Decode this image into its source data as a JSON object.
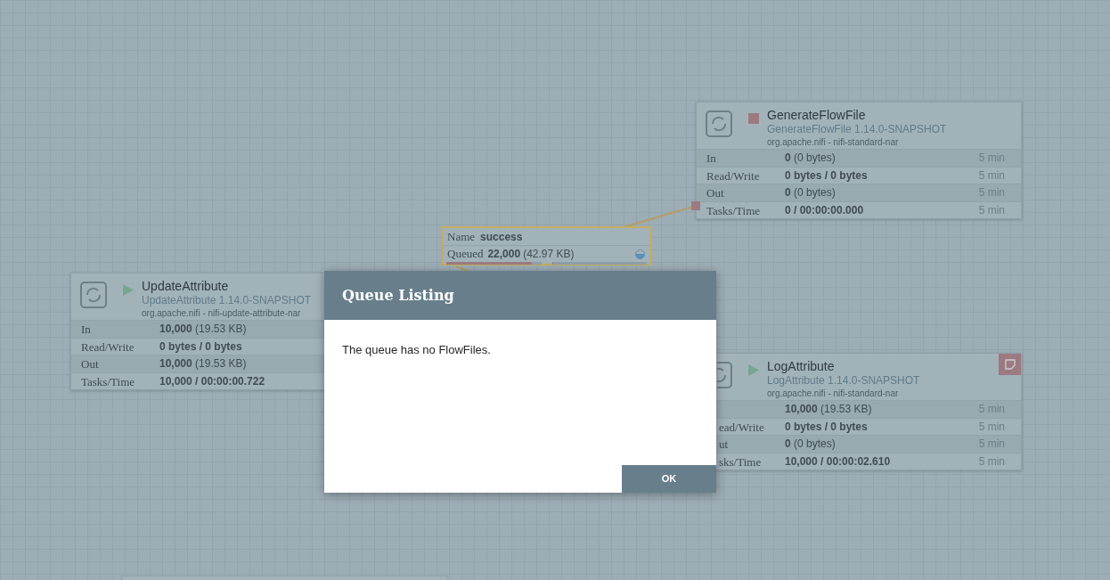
{
  "processors": [
    {
      "name": "GenerateFlowFile",
      "type": "GenerateFlowFile 1.14.0-SNAPSHOT",
      "bundle": "org.apache.nifi - nifi-standard-nar",
      "running": false,
      "bulletin": false,
      "stats": [
        {
          "label": "In",
          "value": "**0** (0 bytes)",
          "period": "5 min"
        },
        {
          "label": "Read/Write",
          "value": "**0 bytes / 0 bytes**",
          "period": "5 min"
        },
        {
          "label": "Out",
          "value": "**0** (0 bytes)",
          "period": "5 min"
        },
        {
          "label": "Tasks/Time",
          "value": "**0 / 00:00:00.000**",
          "period": "5 min"
        }
      ]
    },
    {
      "name": "UpdateAttribute",
      "type": "UpdateAttribute 1.14.0-SNAPSHOT",
      "bundle": "org.apache.nifi - nifi-update-attribute-nar",
      "running": true,
      "bulletin": false,
      "stats": [
        {
          "label": "In",
          "value": "**10,000** (19.53 KB)"
        },
        {
          "label": "Read/Write",
          "value": "**0 bytes / 0 bytes**"
        },
        {
          "label": "Out",
          "value": "**10,000** (19.53 KB)"
        },
        {
          "label": "Tasks/Time",
          "value": "**10,000 / 00:00:00.722**"
        }
      ]
    },
    {
      "name": "LogAttribute",
      "type": "LogAttribute 1.14.0-SNAPSHOT",
      "bundle": "org.apache.nifi - nifi-standard-nar",
      "running": true,
      "bulletin": true,
      "stats": [
        {
          "value": "**10,000** (19.53 KB)",
          "period": "5 min"
        },
        {
          "label": "ead/Write",
          "value": "**0 bytes / 0 bytes**",
          "period": "5 min"
        },
        {
          "label": "ut",
          "value": "**0** (0 bytes)",
          "period": "5 min"
        },
        {
          "label": "sks/Time",
          "value": "**10,000 / 00:00:02.610**",
          "period": "5 min"
        }
      ]
    }
  ],
  "connection": {
    "name_label": "Name",
    "name": "success",
    "queued_label": "Queued",
    "queued_count": "22,000",
    "queued_size": "(42.97 KB)",
    "backpressure": [
      {
        "level": 0.9
      },
      {
        "level": 0
      }
    ]
  },
  "dialog": {
    "title": "Queue Listing",
    "message": "The queue has no FlowFiles.",
    "button": "OK"
  }
}
